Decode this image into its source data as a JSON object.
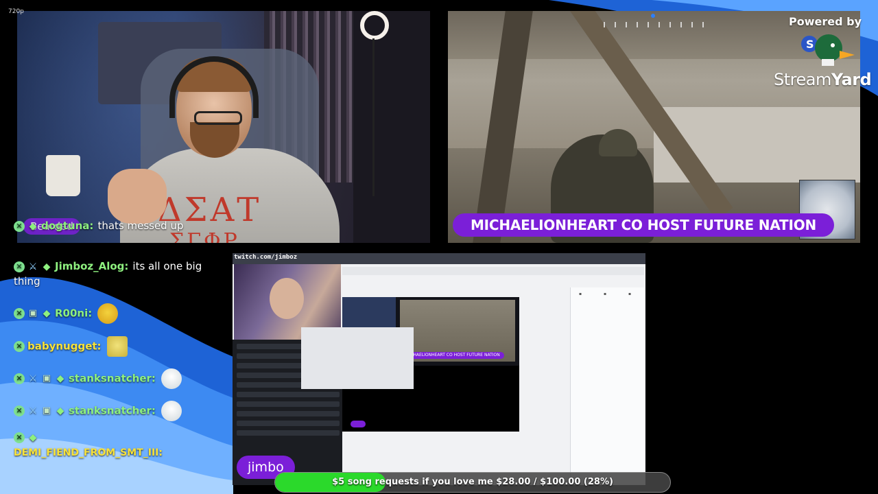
{
  "stream": {
    "quality": "720p",
    "powered_by": "Powered by",
    "brand_light": "Stream",
    "brand_bold": "Yard",
    "title_banner": "MICHAELIONHEART CO HOST FUTURE NATION",
    "webcam_name_pill": "Bearded",
    "share_name_pill": "jimbo",
    "share_url_text": "twitch.com/jimboz",
    "nested_banner": "MICHAELIONHEART CO HOST FUTURE NATION"
  },
  "chat": {
    "messages": [
      {
        "user": "dogtuna:",
        "text": "thats messed up",
        "badges": [
          "x-badge",
          "gem-badge"
        ],
        "emote": ""
      },
      {
        "user": "Jimboz_Alog:",
        "text": "its all one big thing",
        "badges": [
          "x-badge",
          "sword-badge",
          "gem-badge"
        ],
        "emote": ""
      },
      {
        "user": "R00ni:",
        "text": "",
        "badges": [
          "x-badge",
          "gift-badge",
          "gem-badge"
        ],
        "emote": "bean-emote"
      },
      {
        "user": "babynugget:",
        "text": "",
        "badges": [
          "x-badge"
        ],
        "emote": "doge-emote"
      },
      {
        "user": "stanksnatcher:",
        "text": "",
        "badges": [
          "x-badge",
          "sword-badge",
          "gift-badge",
          "gem-badge"
        ],
        "emote": "skull-emote"
      },
      {
        "user": "stanksnatcher:",
        "text": "",
        "badges": [
          "x-badge",
          "sword-badge",
          "gift-badge",
          "gem-badge"
        ],
        "emote": "skull-emote"
      },
      {
        "user": "DEMI_FIEND_FROM_SMT_III:",
        "text": "",
        "badges": [
          "x-badge",
          "gem-badge"
        ],
        "emote": ""
      }
    ]
  },
  "goal": {
    "text": "$5 song requests if you love me $28.00 / $100.00 (28%)",
    "progress": 0.28,
    "fill_color": "#2bd92b"
  },
  "colors": {
    "accent_purple": "#7b1fd8",
    "username_green": "#8ef07f",
    "swoosh_blue": "#1f6fe0"
  }
}
